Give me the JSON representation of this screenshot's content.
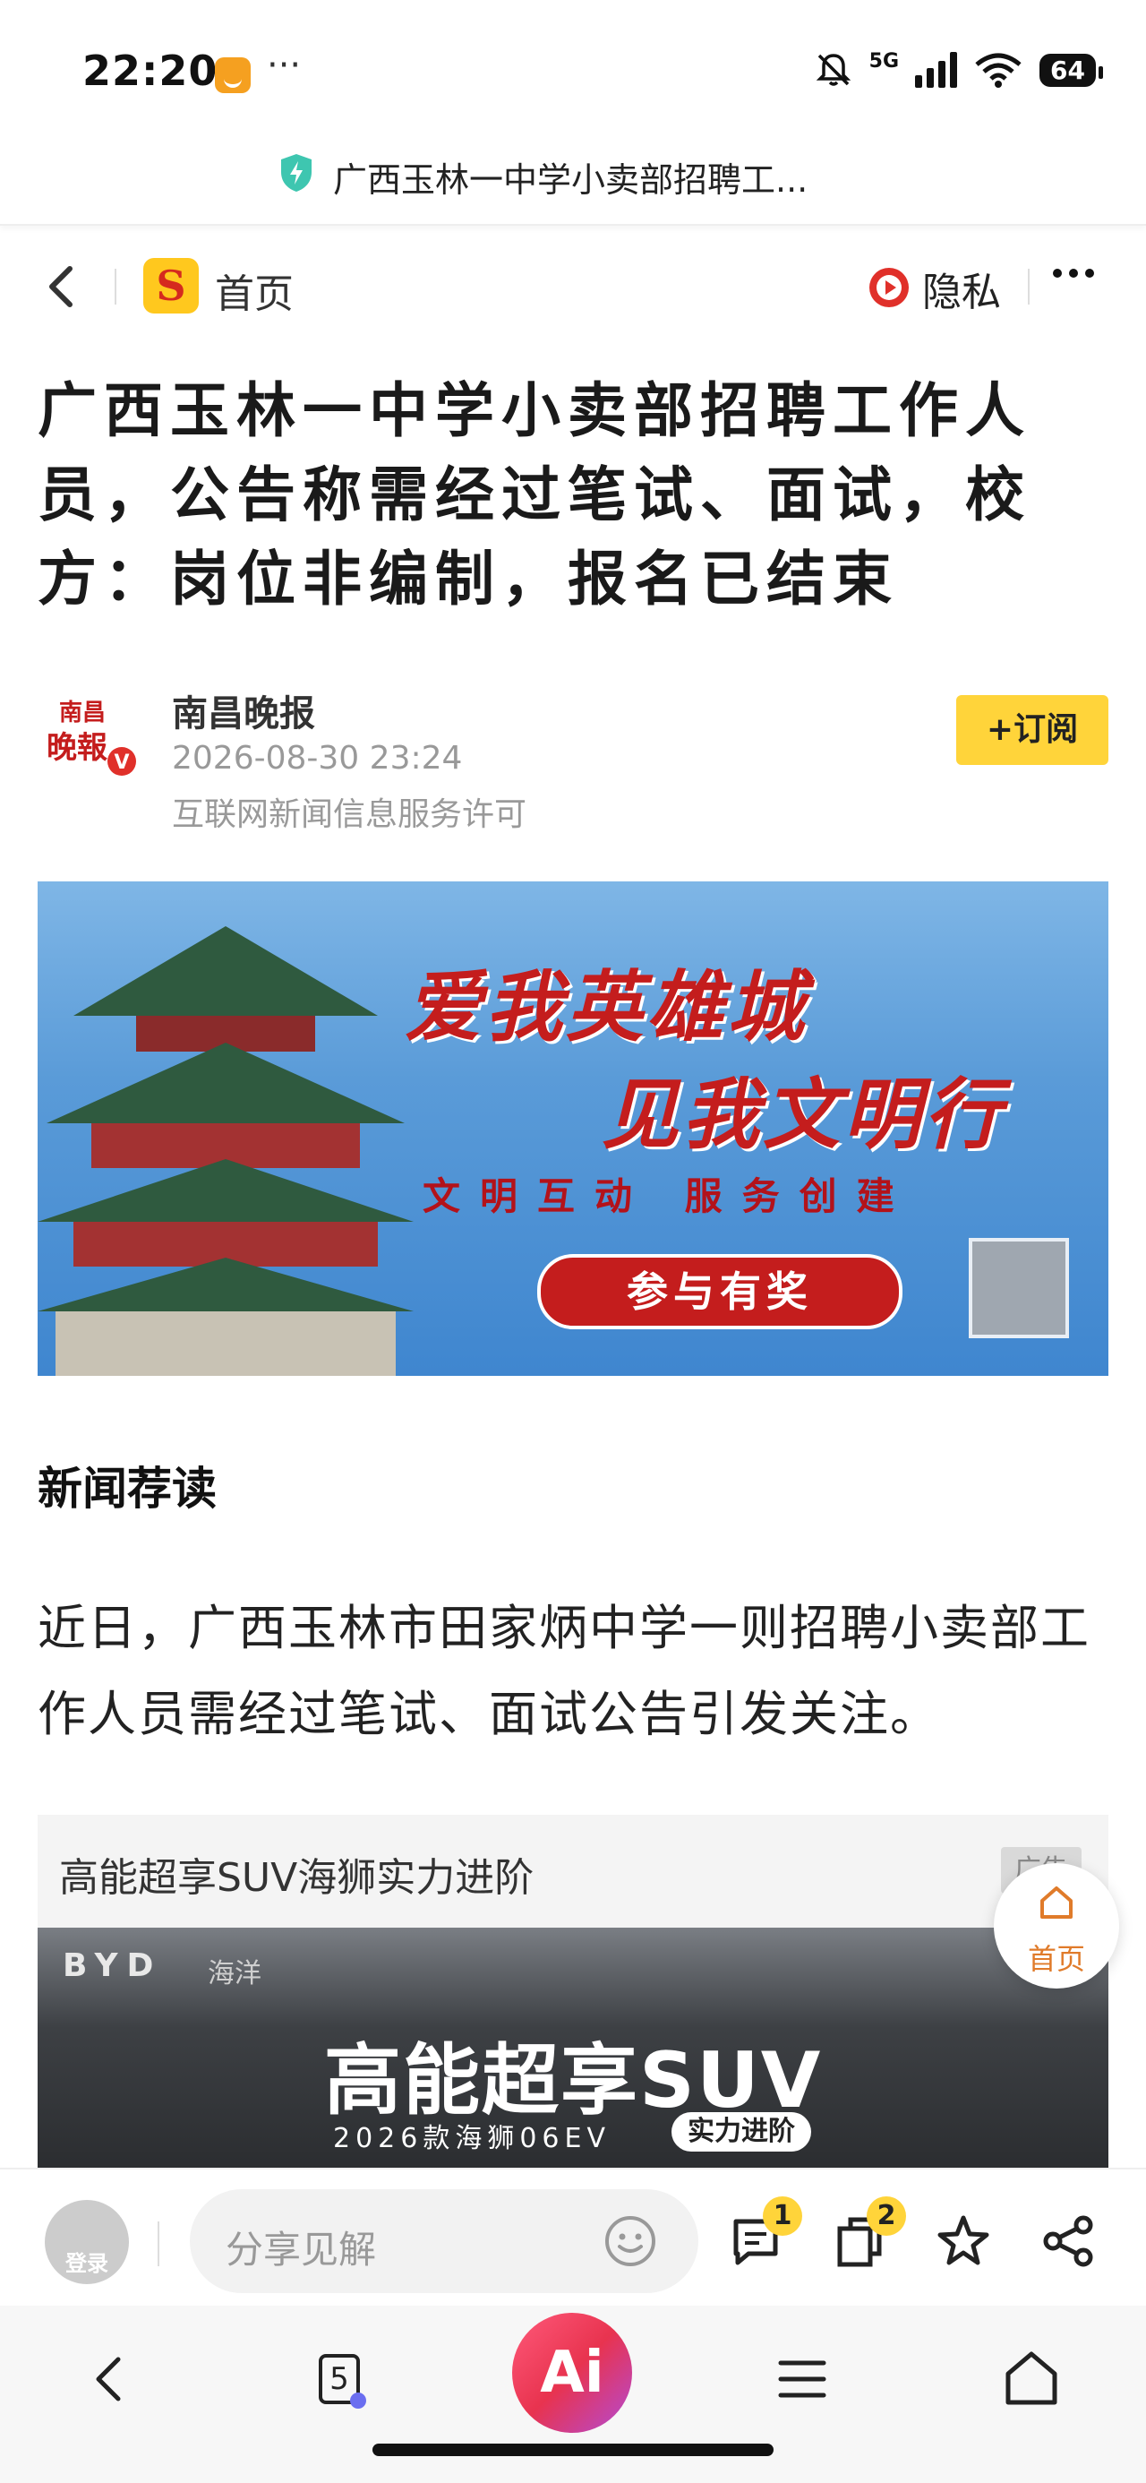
{
  "status_bar": {
    "time": "22:20",
    "signal_label": "5G",
    "battery": "64"
  },
  "url_bar": {
    "title": "广西玉林一中学小卖部招聘工..."
  },
  "top_nav": {
    "home_label": "首页",
    "privacy_label": "隐私"
  },
  "article": {
    "title": "广西玉林一中学小卖部招聘工作人员，公告称需经过笔试、面试，校方：岗位非编制，报名已结束",
    "author_logo_text": "南昌晚报",
    "author": "南昌晚报",
    "date": "2026-08-30 23:24",
    "license": "互联网新闻信息服务许可",
    "subscribe_label": "+订阅",
    "section_title": "新闻荐读",
    "paragraph": "近日，广西玉林市田家炳中学一则招聘小卖部工作人员需经过笔试、面试公告引发关注。"
  },
  "banner": {
    "line1": "爱我英雄城",
    "line2": "见我文明行",
    "sub": "文明互动 服务创建",
    "button": "参与有奖"
  },
  "ad": {
    "title": "高能超享SUV海狮实力进阶",
    "tag": "广告",
    "brand": "BYD",
    "brand_sub": "海洋",
    "headline": "高能超享SUV",
    "sub": "2026款海狮06EV",
    "pill": "实力进阶"
  },
  "float_home": {
    "label": "首页"
  },
  "comment_bar": {
    "login_label": "登录",
    "placeholder": "分享见解",
    "comment_badge": "1",
    "collection_badge": "2"
  },
  "nav_bar": {
    "tabs_count": "5",
    "ai_label": "Ai"
  }
}
